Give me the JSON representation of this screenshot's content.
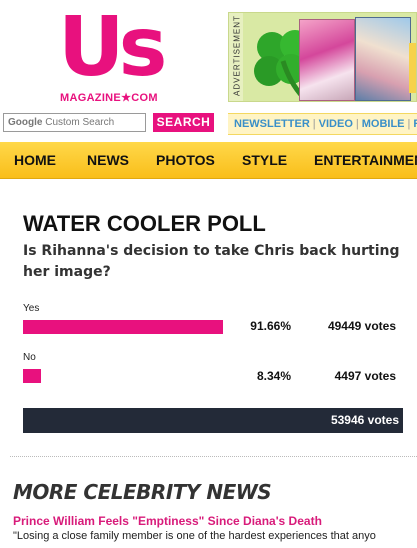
{
  "header": {
    "logo_text": "Us",
    "logo_subtext": "MAGAZINE★COM",
    "ad_label": "ADVERTISEMENT"
  },
  "search": {
    "google_label": "Google",
    "placeholder": "Custom Search",
    "button_label": "SEARCH"
  },
  "top_links": [
    "NEWSLETTER",
    "VIDEO",
    "MOBILE",
    "R"
  ],
  "nav": [
    "HOME",
    "NEWS",
    "PHOTOS",
    "STYLE",
    "ENTERTAINMENT"
  ],
  "poll": {
    "title": "WATER COOLER POLL",
    "question": "Is Rihanna's decision to take Chris back hurting her image?",
    "options": [
      {
        "label": "Yes",
        "percent_text": "91.66%",
        "votes_text": "49449 votes",
        "fraction": 0.9166
      },
      {
        "label": "No",
        "percent_text": "8.34%",
        "votes_text": "4497 votes",
        "fraction": 0.0834
      }
    ],
    "total_text": "53946 votes"
  },
  "more_news": {
    "heading": "MORE CELEBRITY NEWS",
    "headline": "Prince William Feels \"Emptiness\" Since Diana's Death",
    "snippet": "\"Losing a close family member is one of the hardest experiences that anyo"
  },
  "colors": {
    "brand_pink": "#e8117e",
    "nav_yellow": "#f9be1a",
    "link_blue": "#3a8fc8",
    "total_bar": "#232a38"
  }
}
